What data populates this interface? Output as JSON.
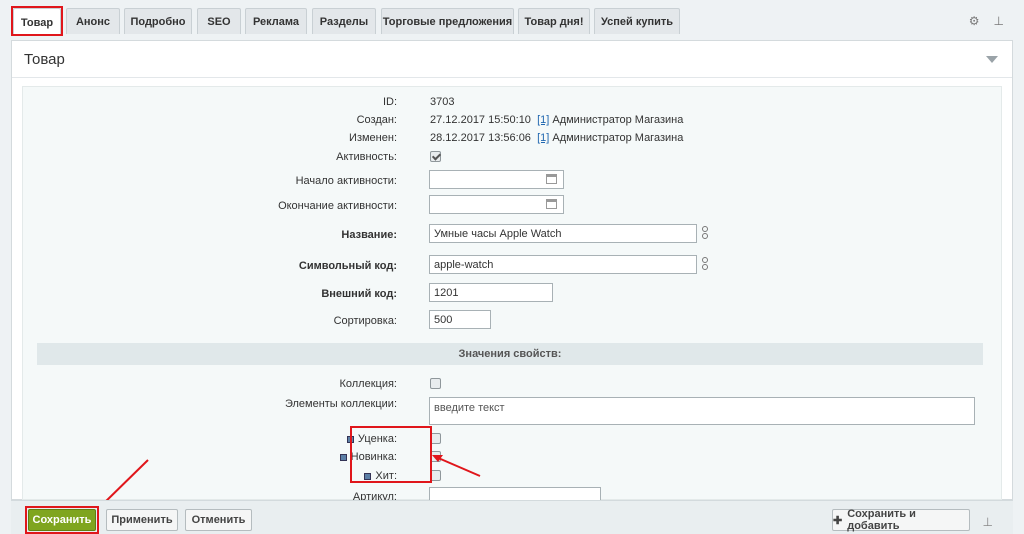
{
  "tabs": [
    "Товар",
    "Анонс",
    "Подробно",
    "SEO",
    "Реклама",
    "Разделы",
    "Торговые предложения",
    "Товар дня!",
    "Успей купить"
  ],
  "tab_tools": {
    "settings_icon": "gear-icon",
    "pin_icon": "pin-icon"
  },
  "panel": {
    "title": "Товар"
  },
  "fields": {
    "id_label": "ID:",
    "id_value": "3703",
    "created_label": "Создан:",
    "created_value": "27.12.2017 15:50:10",
    "created_user_link": "[1]",
    "created_user_name": "Администратор Магазина",
    "modified_label": "Изменен:",
    "modified_value": "28.12.2017 13:56:06",
    "modified_user_link": "[1]",
    "modified_user_name": "Администратор Магазина",
    "active_label": "Активность:",
    "active_from_label": "Начало активности:",
    "active_to_label": "Окончание активности:",
    "name_label": "Название:",
    "name_value": "Умные часы Apple Watch",
    "code_label": "Символьный код:",
    "code_value": "apple-watch",
    "xml_label": "Внешний код:",
    "xml_value": "1201",
    "sort_label": "Сортировка:",
    "sort_value": "500"
  },
  "properties": {
    "section_title": "Значения свойств:",
    "collection_label": "Коллекция:",
    "collection_items_label": "Элементы коллекции:",
    "collection_items_placeholder": "введите текст",
    "discount_label": "Уценка:",
    "new_label": "Новинка:",
    "hit_label": "Хит:",
    "article_label": "Артикул:"
  },
  "footer": {
    "save_label": "Сохранить",
    "apply_label": "Применить",
    "cancel_label": "Отменить",
    "save_add_label": "Сохранить и добавить"
  },
  "colors": {
    "highlight": "#e0161b",
    "save_button": "#7fa51f"
  }
}
